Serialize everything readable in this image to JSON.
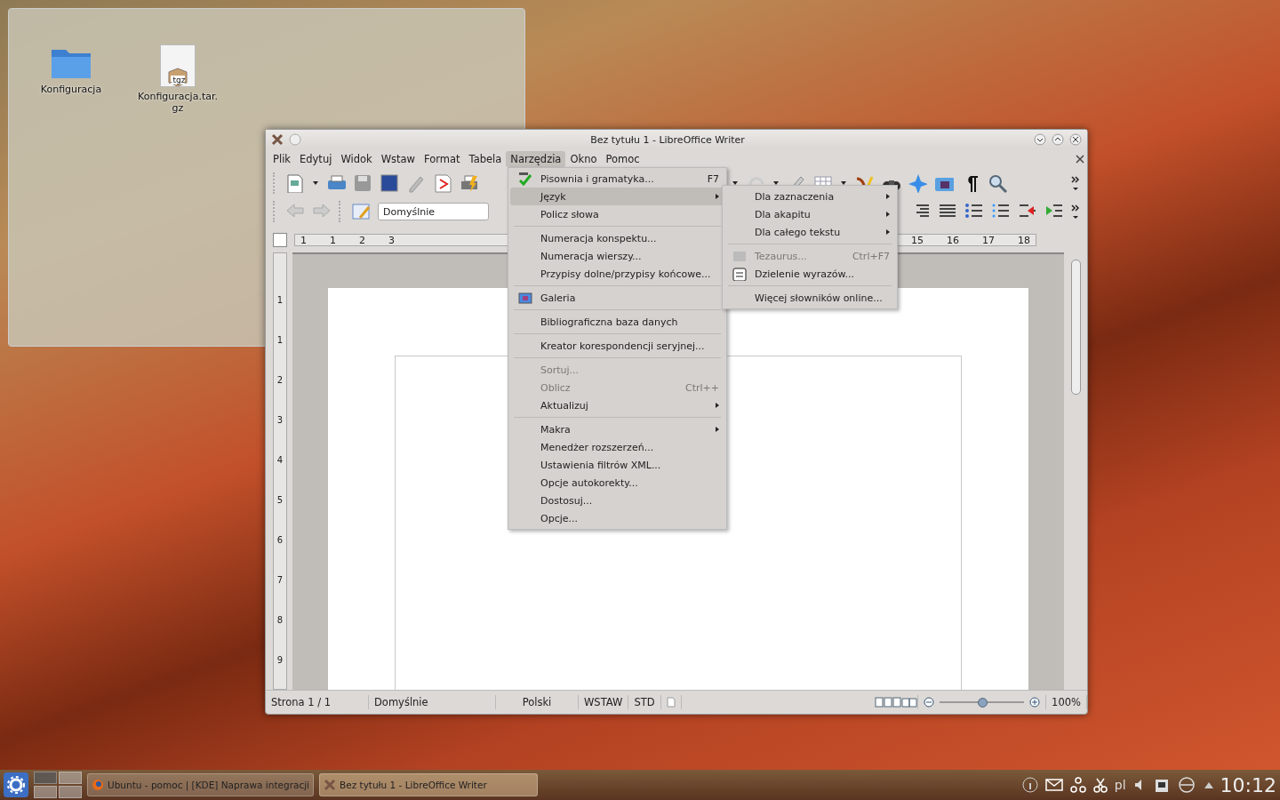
{
  "desktop": {
    "folder_view": {
      "items": [
        {
          "kind": "folder",
          "label": "Konfiguracja"
        },
        {
          "kind": "archive",
          "badge": ".tgz",
          "label": "Konfiguracja.tar.gz"
        }
      ]
    }
  },
  "window": {
    "title": "Bez tytułu 1 - LibreOffice Writer",
    "menu_bar": [
      {
        "label": "Plik",
        "selected": false
      },
      {
        "label": "Edytuj",
        "selected": false
      },
      {
        "label": "Widok",
        "selected": false
      },
      {
        "label": "Wstaw",
        "selected": false
      },
      {
        "label": "Format",
        "selected": false
      },
      {
        "label": "Tabela",
        "selected": false
      },
      {
        "label": "Narzędzia",
        "selected": true
      },
      {
        "label": "Okno",
        "selected": false
      },
      {
        "label": "Pomoc",
        "selected": false
      }
    ],
    "style_box": {
      "value": "Domyślnie"
    },
    "ruler": {
      "left_marks": [
        "1",
        "1",
        "2",
        "3"
      ],
      "right_marks": [
        "15",
        "16",
        "17",
        "18"
      ],
      "vertical_marks": [
        "1",
        "1",
        "2",
        "3",
        "4",
        "5",
        "6",
        "7",
        "8",
        "9"
      ]
    },
    "status_bar": [
      {
        "kind": "text",
        "text": "Strona 1 / 1"
      },
      {
        "kind": "text",
        "text": "Domyślnie"
      },
      {
        "kind": "center",
        "text": "Polski"
      },
      {
        "kind": "text",
        "text": "WSTAW"
      },
      {
        "kind": "text",
        "text": "STD"
      }
    ],
    "zoom": {
      "level": 0.5,
      "reading": "100%"
    }
  },
  "tools_menu": {
    "items": [
      {
        "kind": "item",
        "label": "Pisownia i gramatyka...",
        "shortcut": "F7",
        "disabled": false,
        "submenu": false,
        "selected": false
      },
      {
        "kind": "item",
        "label": "Język",
        "disabled": false,
        "submenu": true,
        "selected": true
      },
      {
        "kind": "item",
        "label": "Policz słowa",
        "disabled": false,
        "submenu": false,
        "selected": false
      },
      {
        "kind": "separator"
      },
      {
        "kind": "item",
        "label": "Numeracja konspektu...",
        "disabled": false,
        "submenu": false,
        "selected": false
      },
      {
        "kind": "item",
        "label": "Numeracja wierszy...",
        "disabled": false,
        "submenu": false,
        "selected": false
      },
      {
        "kind": "item",
        "label": "Przypisy dolne/przypisy końcowe...",
        "disabled": false,
        "submenu": false,
        "selected": false
      },
      {
        "kind": "separator"
      },
      {
        "kind": "item",
        "label": "Galeria",
        "disabled": false,
        "submenu": false,
        "selected": false
      },
      {
        "kind": "separator"
      },
      {
        "kind": "item",
        "label": "Bibliograficzna baza danych",
        "disabled": false,
        "submenu": false,
        "selected": false
      },
      {
        "kind": "separator"
      },
      {
        "kind": "item",
        "label": "Kreator korespondencji seryjnej...",
        "disabled": false,
        "submenu": false,
        "selected": false
      },
      {
        "kind": "separator"
      },
      {
        "kind": "item",
        "label": "Sortuj...",
        "disabled": true,
        "submenu": false,
        "selected": false
      },
      {
        "kind": "item",
        "label": "Oblicz",
        "shortcut": "Ctrl++",
        "disabled": true,
        "submenu": false,
        "selected": false
      },
      {
        "kind": "item",
        "label": "Aktualizuj",
        "disabled": false,
        "submenu": true,
        "selected": false
      },
      {
        "kind": "separator"
      },
      {
        "kind": "item",
        "label": "Makra",
        "disabled": false,
        "submenu": true,
        "selected": false
      },
      {
        "kind": "item",
        "label": "Menedżer rozszerzeń...",
        "disabled": false,
        "submenu": false,
        "selected": false
      },
      {
        "kind": "item",
        "label": "Ustawienia filtrów XML...",
        "disabled": false,
        "submenu": false,
        "selected": false
      },
      {
        "kind": "item",
        "label": "Opcje autokorekty...",
        "disabled": false,
        "submenu": false,
        "selected": false
      },
      {
        "kind": "item",
        "label": "Dostosuj...",
        "disabled": false,
        "submenu": false,
        "selected": false
      },
      {
        "kind": "item",
        "label": "Opcje...",
        "disabled": false,
        "submenu": false,
        "selected": false
      }
    ]
  },
  "language_submenu": {
    "items": [
      {
        "kind": "item",
        "label": "Dla zaznaczenia",
        "disabled": false,
        "submenu": true
      },
      {
        "kind": "item",
        "label": "Dla akapitu",
        "disabled": false,
        "submenu": true
      },
      {
        "kind": "item",
        "label": "Dla całego tekstu",
        "disabled": false,
        "submenu": true
      },
      {
        "kind": "separator"
      },
      {
        "kind": "item",
        "label": "Tezaurus...",
        "shortcut": "Ctrl+F7",
        "disabled": true,
        "submenu": false
      },
      {
        "kind": "item",
        "label": "Dzielenie wyrazów...",
        "disabled": false,
        "submenu": false
      },
      {
        "kind": "separator"
      },
      {
        "kind": "item",
        "label": "Więcej słowników online...",
        "disabled": false,
        "submenu": false
      }
    ]
  },
  "taskbar": {
    "tasks": [
      {
        "label": "Ubuntu - pomoc | [KDE] Naprawa integracji",
        "selected": false
      },
      {
        "label": "Bez tytułu 1 - LibreOffice Writer",
        "selected": true
      }
    ],
    "keyboard_layout": "pl",
    "clock": "10:12"
  }
}
